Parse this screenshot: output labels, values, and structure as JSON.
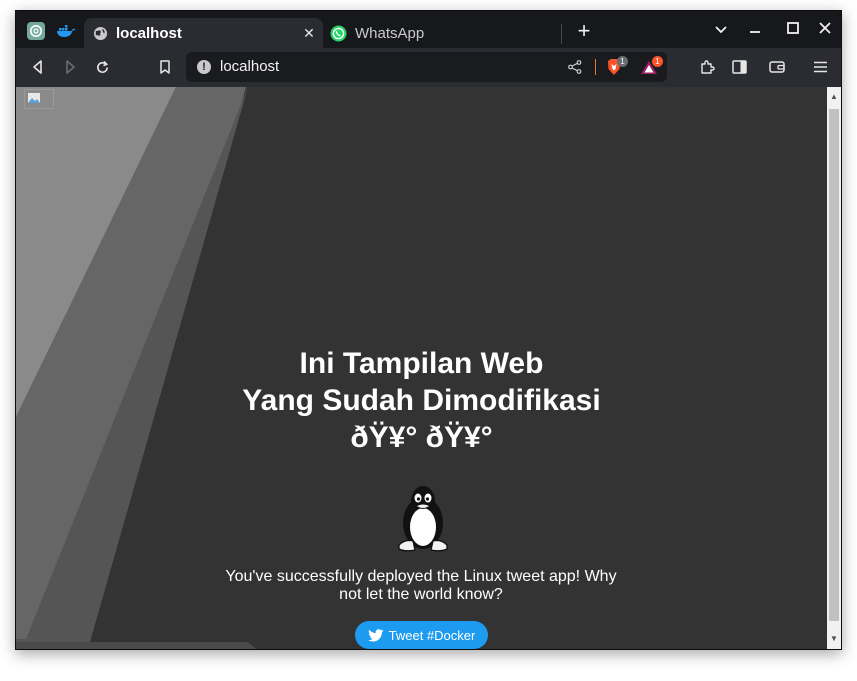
{
  "tabs": {
    "active": {
      "title": "localhost",
      "close": "✕"
    },
    "inactive": {
      "title": "WhatsApp"
    },
    "new_tab": "+"
  },
  "window_controls": {
    "menu": "⌄",
    "minimize": "–",
    "maximize": "☐",
    "close": "✕"
  },
  "toolbar": {
    "url": "localhost",
    "brave_shields_count": "1",
    "rewards_count": "1"
  },
  "page": {
    "headline_line1": "Ini Tampilan Web",
    "headline_line2": "Yang Sudah Dimodifikasi",
    "headline_line3": "ðŸ¥° ðŸ¥°",
    "message": "You've successfully deployed the Linux tweet app! Why not let the world know?",
    "tweet_button": "Tweet #Docker"
  },
  "colors": {
    "page_background": "#333333",
    "tweet_button": "#1d9bf0",
    "brave_orange": "#fb542b"
  },
  "icons": {
    "pinned_tab_1": "chatgpt-icon",
    "pinned_tab_2": "docker-icon",
    "active_tab": "globe-icon",
    "inactive_tab": "whatsapp-icon"
  }
}
